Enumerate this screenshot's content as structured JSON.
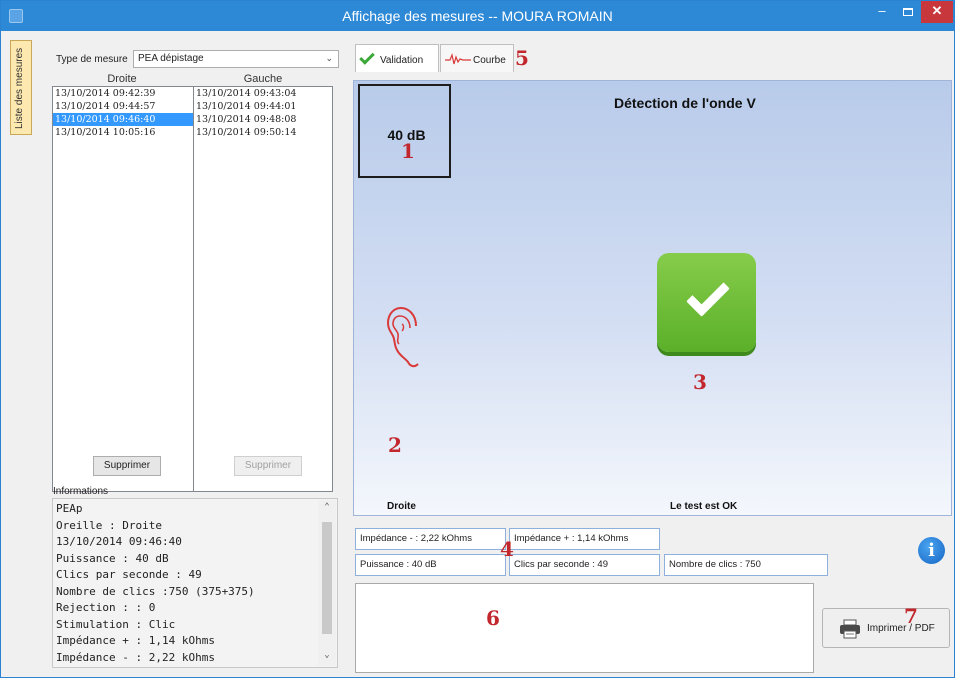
{
  "window": {
    "title": "Affichage des mesures -- MOURA ROMAIN",
    "minimize_glyph": "–",
    "close_glyph": "✕"
  },
  "side_tab": {
    "label": "Liste des mesures"
  },
  "left": {
    "type_label": "Type de mesure",
    "type_value": "PEA dépistage",
    "col_right": "Droite",
    "col_left": "Gauche",
    "right_list": [
      "13/10/2014 09:42:39",
      "13/10/2014 09:44:57",
      "13/10/2014 09:46:40",
      "13/10/2014 10:05:16"
    ],
    "right_selected_index": 2,
    "left_list": [
      "13/10/2014 09:43:04",
      "13/10/2014 09:44:01",
      "13/10/2014 09:48:08",
      "13/10/2014 09:50:14"
    ],
    "delete_right": "Supprimer",
    "delete_left": "Supprimer",
    "info_label": "Informations",
    "info_lines": [
      "PEAp",
      "Oreille : Droite",
      "13/10/2014 09:46:40",
      "Puissance : 40 dB",
      "Clics par seconde : 49",
      "Nombre de clics :750 (375+375)",
      "Rejection :  : 0",
      "Stimulation : Clic",
      "Impédance + : 1,14 kOhms",
      "Impédance - : 2,22 kOhms"
    ]
  },
  "tabs": {
    "validation": "Validation",
    "courbe": "Courbe"
  },
  "main": {
    "level": "40 dB",
    "title": "Détection de l'onde V",
    "side": "Droite",
    "result": "Le test est OK"
  },
  "measures": {
    "imp_minus": "Impédance - : 2,22 kOhms",
    "imp_plus": "Impédance + : 1,14 kOhms",
    "power": "Puissance : 40 dB",
    "clicks_per_sec": "Clics par seconde : 49",
    "clicks_count": "Nombre de clics : 750"
  },
  "info_icon_glyph": "i",
  "print_label": "Imprimer / PDF",
  "annotations": {
    "n1": "1",
    "n2": "2",
    "n3": "3",
    "n4": "4",
    "n5": "5",
    "n6": "6",
    "n7": "7"
  },
  "colors": {
    "accent": "#2d89d6",
    "selection": "#3399ff",
    "ok_green": "#5bb029",
    "annotation_red": "#c1272d"
  }
}
